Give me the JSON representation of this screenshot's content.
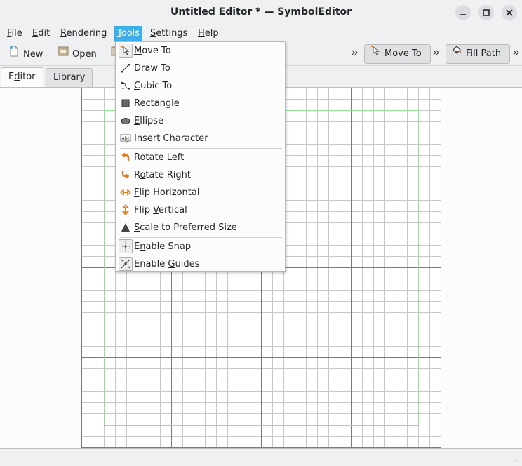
{
  "window": {
    "title": "Untitled Editor * — SymbolEditor",
    "controls": [
      "minimize-icon",
      "maximize-icon",
      "close-icon"
    ]
  },
  "menubar": {
    "items": [
      {
        "key": "file",
        "text": "File",
        "mnemonic": "F",
        "rest": "ile"
      },
      {
        "key": "edit",
        "text": "Edit",
        "mnemonic": "E",
        "rest": "dit"
      },
      {
        "key": "rendering",
        "text": "Rendering",
        "mnemonic": "R",
        "rest": "endering"
      },
      {
        "key": "tools",
        "text": "Tools",
        "mnemonic": "T",
        "rest": "ools"
      },
      {
        "key": "settings",
        "text": "Settings",
        "mnemonic": "S",
        "rest": "ettings"
      },
      {
        "key": "help",
        "text": "Help",
        "mnemonic": "H",
        "rest": "elp"
      }
    ],
    "active": "Tools"
  },
  "toolbar": {
    "new_label": "New",
    "open_label": "Open",
    "overflow_glyph": "›",
    "move_to_label": "Move To",
    "fill_path_label": "Fill Path"
  },
  "tabs": {
    "editor": {
      "pre": "E",
      "mn": "d",
      "post": "itor"
    },
    "library": {
      "pre": "",
      "mn": "L",
      "post": "ibrary"
    }
  },
  "tools_menu": {
    "items": [
      {
        "pre": "",
        "mn": "M",
        "post": "ove To",
        "icon": "move-to-icon",
        "checked": true
      },
      {
        "pre": "",
        "mn": "D",
        "post": "raw To",
        "icon": "draw-to-icon",
        "checked": false
      },
      {
        "pre": "",
        "mn": "C",
        "post": "ubic To",
        "icon": "cubic-to-icon",
        "checked": false
      },
      {
        "pre": "",
        "mn": "R",
        "post": "ectangle",
        "icon": "rectangle-icon",
        "checked": false
      },
      {
        "pre": "",
        "mn": "E",
        "post": "llipse",
        "icon": "ellipse-icon",
        "checked": false
      },
      {
        "pre": "",
        "mn": "I",
        "post": "nsert Character",
        "icon": "insert-character-icon",
        "checked": false
      },
      {
        "pre": "Rotate ",
        "mn": "L",
        "post": "eft",
        "icon": "rotate-left-icon",
        "checked": false
      },
      {
        "pre": "R",
        "mn": "o",
        "post": "tate Right",
        "icon": "rotate-right-icon",
        "checked": false
      },
      {
        "pre": "",
        "mn": "F",
        "post": "lip Horizontal",
        "icon": "flip-horizontal-icon",
        "checked": false
      },
      {
        "pre": "Flip ",
        "mn": "V",
        "post": "ertical",
        "icon": "flip-vertical-icon",
        "checked": false
      },
      {
        "pre": "",
        "mn": "S",
        "post": "cale to Preferred Size",
        "icon": "scale-icon",
        "checked": false
      },
      {
        "pre": "E",
        "mn": "n",
        "post": "able Snap",
        "icon": "snap-icon",
        "checked": true
      },
      {
        "pre": "Enable ",
        "mn": "G",
        "post": "uides",
        "icon": "guides-icon",
        "checked": true
      }
    ]
  },
  "colors": {
    "accent": "#3daee9",
    "guide": "#8fe08f",
    "icon_orange": "#e07b20"
  }
}
